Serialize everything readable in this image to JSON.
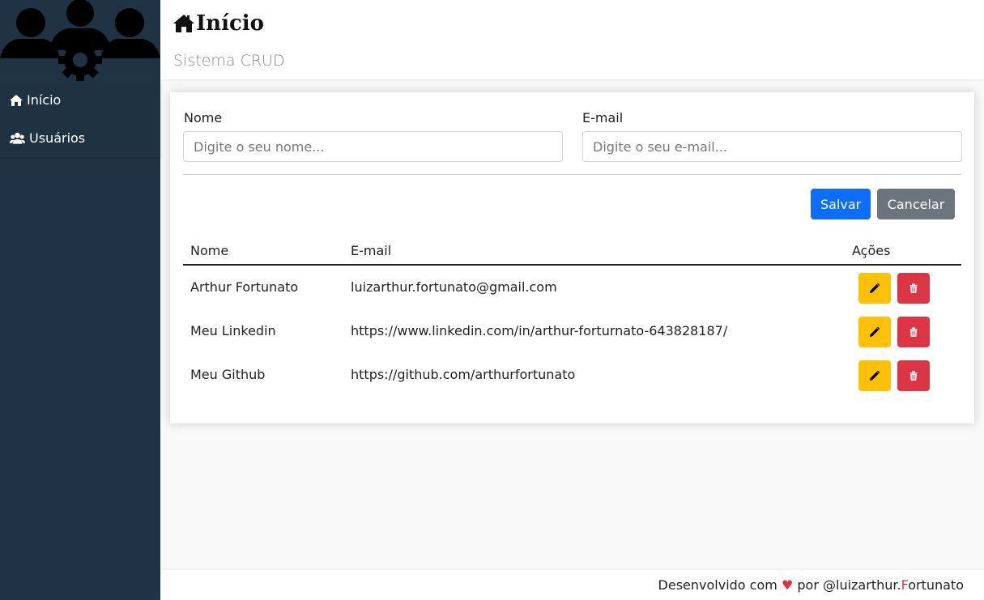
{
  "sidebar": {
    "logo_icon": "users-gear-logo",
    "items": [
      {
        "icon": "home-icon",
        "label": "Início"
      },
      {
        "icon": "users-icon",
        "label": "Usuários"
      }
    ]
  },
  "header": {
    "title": "Início",
    "subtitle": "Sistema CRUD"
  },
  "form": {
    "name_label": "Nome",
    "name_placeholder": "Digite o seu nome...",
    "name_value": "",
    "email_label": "E-mail",
    "email_placeholder": "Digite o seu e-mail...",
    "email_value": "",
    "save_label": "Salvar",
    "cancel_label": "Cancelar"
  },
  "table": {
    "columns": [
      "Nome",
      "E-mail",
      "Ações"
    ],
    "rows": [
      {
        "name": "Arthur Fortunato",
        "email": "luizarthur.fortunato@gmail.com"
      },
      {
        "name": "Meu Linkedin",
        "email": "https://www.linkedin.com/in/arthur-forturnato-643828187/"
      },
      {
        "name": "Meu Github",
        "email": "https://github.com/arthurfortunato"
      }
    ]
  },
  "footer": {
    "prefix": "Desenvolvido com",
    "suffix": "por @luizarthur.",
    "accent_letter": "F",
    "rest": "ortunato"
  },
  "colors": {
    "sidebar": "#1f3344",
    "primary": "#0d6efd",
    "secondary": "#6c757d",
    "warning": "#ffc107",
    "danger": "#dc3545"
  }
}
